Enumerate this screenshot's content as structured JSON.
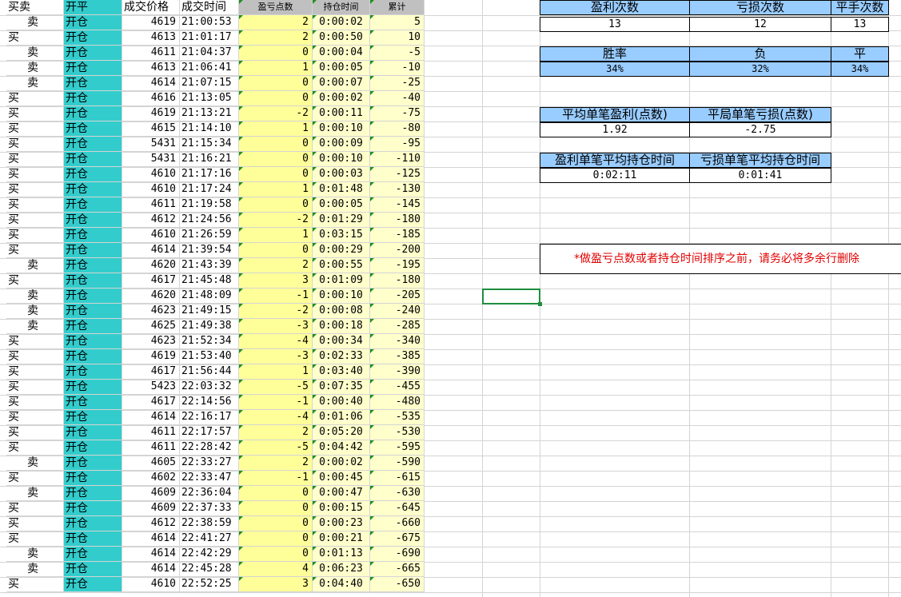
{
  "headers": {
    "side": "买卖",
    "open_close": "开平",
    "price": "成交价格",
    "time": "成交时间",
    "pnl": "盈亏点数",
    "hold": "持仓时间",
    "cum": "累计"
  },
  "rows": [
    {
      "side": "卖",
      "oc": "开仓",
      "price": "4619",
      "time": "21:00:53",
      "pnl": "2",
      "hold": "0:00:02",
      "cum": "5"
    },
    {
      "side": "买",
      "oc": "开仓",
      "price": "4613",
      "time": "21:01:17",
      "pnl": "2",
      "hold": "0:00:50",
      "cum": "10"
    },
    {
      "side": "卖",
      "oc": "开仓",
      "price": "4611",
      "time": "21:04:37",
      "pnl": "0",
      "hold": "0:00:04",
      "cum": "-5"
    },
    {
      "side": "卖",
      "oc": "开仓",
      "price": "4613",
      "time": "21:06:41",
      "pnl": "1",
      "hold": "0:00:05",
      "cum": "-10"
    },
    {
      "side": "卖",
      "oc": "开仓",
      "price": "4614",
      "time": "21:07:15",
      "pnl": "0",
      "hold": "0:00:07",
      "cum": "-25"
    },
    {
      "side": "买",
      "oc": "开仓",
      "price": "4616",
      "time": "21:13:05",
      "pnl": "0",
      "hold": "0:00:02",
      "cum": "-40"
    },
    {
      "side": "买",
      "oc": "开仓",
      "price": "4619",
      "time": "21:13:21",
      "pnl": "-2",
      "hold": "0:00:11",
      "cum": "-75"
    },
    {
      "side": "买",
      "oc": "开仓",
      "price": "4615",
      "time": "21:14:10",
      "pnl": "1",
      "hold": "0:00:10",
      "cum": "-80"
    },
    {
      "side": "买",
      "oc": "开仓",
      "price": "5431",
      "time": "21:15:34",
      "pnl": "0",
      "hold": "0:00:09",
      "cum": "-95"
    },
    {
      "side": "买",
      "oc": "开仓",
      "price": "5431",
      "time": "21:16:21",
      "pnl": "0",
      "hold": "0:00:10",
      "cum": "-110"
    },
    {
      "side": "买",
      "oc": "开仓",
      "price": "4610",
      "time": "21:17:16",
      "pnl": "0",
      "hold": "0:00:03",
      "cum": "-125"
    },
    {
      "side": "买",
      "oc": "开仓",
      "price": "4610",
      "time": "21:17:24",
      "pnl": "1",
      "hold": "0:01:48",
      "cum": "-130"
    },
    {
      "side": "买",
      "oc": "开仓",
      "price": "4611",
      "time": "21:19:58",
      "pnl": "0",
      "hold": "0:00:05",
      "cum": "-145"
    },
    {
      "side": "买",
      "oc": "开仓",
      "price": "4612",
      "time": "21:24:56",
      "pnl": "-2",
      "hold": "0:01:29",
      "cum": "-180"
    },
    {
      "side": "买",
      "oc": "开仓",
      "price": "4610",
      "time": "21:26:59",
      "pnl": "1",
      "hold": "0:03:15",
      "cum": "-185"
    },
    {
      "side": "买",
      "oc": "开仓",
      "price": "4614",
      "time": "21:39:54",
      "pnl": "0",
      "hold": "0:00:29",
      "cum": "-200"
    },
    {
      "side": "卖",
      "oc": "开仓",
      "price": "4620",
      "time": "21:43:39",
      "pnl": "2",
      "hold": "0:00:55",
      "cum": "-195"
    },
    {
      "side": "买",
      "oc": "开仓",
      "price": "4617",
      "time": "21:45:48",
      "pnl": "3",
      "hold": "0:01:09",
      "cum": "-180"
    },
    {
      "side": "卖",
      "oc": "开仓",
      "price": "4620",
      "time": "21:48:09",
      "pnl": "-1",
      "hold": "0:00:10",
      "cum": "-205"
    },
    {
      "side": "卖",
      "oc": "开仓",
      "price": "4623",
      "time": "21:49:15",
      "pnl": "-2",
      "hold": "0:00:08",
      "cum": "-240"
    },
    {
      "side": "卖",
      "oc": "开仓",
      "price": "4625",
      "time": "21:49:38",
      "pnl": "-3",
      "hold": "0:00:18",
      "cum": "-285"
    },
    {
      "side": "买",
      "oc": "开仓",
      "price": "4623",
      "time": "21:52:34",
      "pnl": "-4",
      "hold": "0:00:34",
      "cum": "-340"
    },
    {
      "side": "买",
      "oc": "开仓",
      "price": "4619",
      "time": "21:53:40",
      "pnl": "-3",
      "hold": "0:02:33",
      "cum": "-385"
    },
    {
      "side": "买",
      "oc": "开仓",
      "price": "4617",
      "time": "21:56:44",
      "pnl": "1",
      "hold": "0:03:40",
      "cum": "-390"
    },
    {
      "side": "买",
      "oc": "开仓",
      "price": "5423",
      "time": "22:03:32",
      "pnl": "-5",
      "hold": "0:07:35",
      "cum": "-455"
    },
    {
      "side": "买",
      "oc": "开仓",
      "price": "4617",
      "time": "22:14:56",
      "pnl": "-1",
      "hold": "0:00:40",
      "cum": "-480"
    },
    {
      "side": "买",
      "oc": "开仓",
      "price": "4614",
      "time": "22:16:17",
      "pnl": "-4",
      "hold": "0:01:06",
      "cum": "-535"
    },
    {
      "side": "买",
      "oc": "开仓",
      "price": "4611",
      "time": "22:17:57",
      "pnl": "2",
      "hold": "0:05:20",
      "cum": "-530"
    },
    {
      "side": "买",
      "oc": "开仓",
      "price": "4611",
      "time": "22:28:42",
      "pnl": "-5",
      "hold": "0:04:42",
      "cum": "-595"
    },
    {
      "side": "卖",
      "oc": "开仓",
      "price": "4605",
      "time": "22:33:27",
      "pnl": "2",
      "hold": "0:00:02",
      "cum": "-590"
    },
    {
      "side": "买",
      "oc": "开仓",
      "price": "4602",
      "time": "22:33:47",
      "pnl": "-1",
      "hold": "0:00:45",
      "cum": "-615"
    },
    {
      "side": "卖",
      "oc": "开仓",
      "price": "4609",
      "time": "22:36:04",
      "pnl": "0",
      "hold": "0:00:47",
      "cum": "-630"
    },
    {
      "side": "买",
      "oc": "开仓",
      "price": "4609",
      "time": "22:37:33",
      "pnl": "0",
      "hold": "0:00:15",
      "cum": "-645"
    },
    {
      "side": "买",
      "oc": "开仓",
      "price": "4612",
      "time": "22:38:59",
      "pnl": "0",
      "hold": "0:00:23",
      "cum": "-660"
    },
    {
      "side": "买",
      "oc": "开仓",
      "price": "4614",
      "time": "22:41:27",
      "pnl": "0",
      "hold": "0:00:21",
      "cum": "-675"
    },
    {
      "side": "卖",
      "oc": "开仓",
      "price": "4614",
      "time": "22:42:29",
      "pnl": "0",
      "hold": "0:01:13",
      "cum": "-690"
    },
    {
      "side": "卖",
      "oc": "开仓",
      "price": "4614",
      "time": "22:45:28",
      "pnl": "4",
      "hold": "0:06:23",
      "cum": "-665"
    },
    {
      "side": "买",
      "oc": "开仓",
      "price": "4610",
      "time": "22:52:25",
      "pnl": "3",
      "hold": "0:04:40",
      "cum": "-650"
    }
  ],
  "stats": {
    "counts_headers": [
      "盈利次数",
      "亏损次数",
      "平手次数"
    ],
    "counts_values": [
      "13",
      "12",
      "13"
    ],
    "rate_headers": [
      "胜率",
      "负",
      "平"
    ],
    "rate_values": [
      "34%",
      "32%",
      "34%"
    ],
    "avg_headers": [
      "平均单笔盈利(点数)",
      "平局单笔亏损(点数)"
    ],
    "avg_values": [
      "1.92",
      "-2.75"
    ],
    "hold_headers": [
      "盈利单笔平均持仓时间",
      "亏损单笔平均持仓时间"
    ],
    "hold_values": [
      "0:02:11",
      "0:01:41"
    ]
  },
  "note": "*做盈亏点数或者持仓时间排序之前，请务必将多余行删除",
  "colors": {
    "teal": "#33cccc",
    "yellow": "#ffff99",
    "light_yellow": "#ffffcc",
    "stat_header": "#99ccff",
    "note_red": "#e00000",
    "selection": "#1e8e3e"
  }
}
